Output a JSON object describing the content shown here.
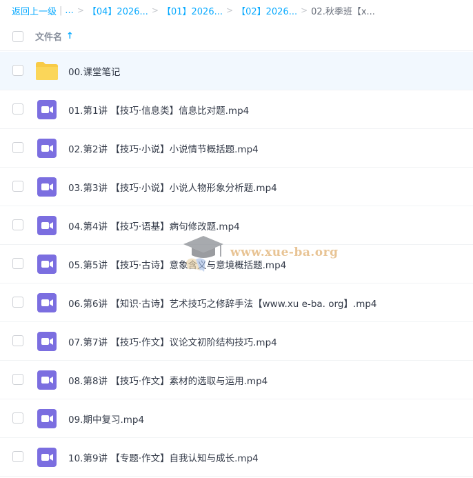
{
  "breadcrumb": {
    "back": "返回上一级",
    "pipe": "|",
    "ellipsis": "...",
    "sep": ">",
    "items": [
      "【04】2026...",
      "【01】2026...",
      "【02】2026..."
    ],
    "current": "02.秋季班【x..."
  },
  "header": {
    "col_name": "文件名",
    "sort_arrow": "↑"
  },
  "files": [
    {
      "name": "00.课堂笔记",
      "type": "folder"
    },
    {
      "name": "01.第1讲 【技巧·信息类】信息比对题.mp4",
      "type": "video"
    },
    {
      "name": "02.第2讲 【技巧·小说】小说情节概括题.mp4",
      "type": "video"
    },
    {
      "name": "03.第3讲 【技巧·小说】小说人物形象分析题.mp4",
      "type": "video"
    },
    {
      "name": "04.第4讲 【技巧·语基】病句修改题.mp4",
      "type": "video"
    },
    {
      "name": "05.第5讲 【技巧·古诗】意象含义与意境概括题.mp4",
      "type": "video"
    },
    {
      "name": "06.第6讲 【知识·古诗】艺术技巧之修辞手法【www.xu e-ba. org】.mp4",
      "type": "video"
    },
    {
      "name": "07.第7讲 【技巧·作文】议论文初阶结构技巧.mp4",
      "type": "video"
    },
    {
      "name": "08.第8讲 【技巧·作文】素材的选取与运用.mp4",
      "type": "video"
    },
    {
      "name": "09.期中复习.mp4",
      "type": "video"
    },
    {
      "name": "10.第9讲 【专题·作文】自我认知与成长.mp4",
      "type": "video"
    }
  ],
  "watermark": {
    "text": "www.xue-ba.org"
  },
  "colors": {
    "accent": "#09aaff",
    "folder": "#f8cb47",
    "video": "#7b6ee0",
    "selected_row": "#f2f8fe"
  }
}
